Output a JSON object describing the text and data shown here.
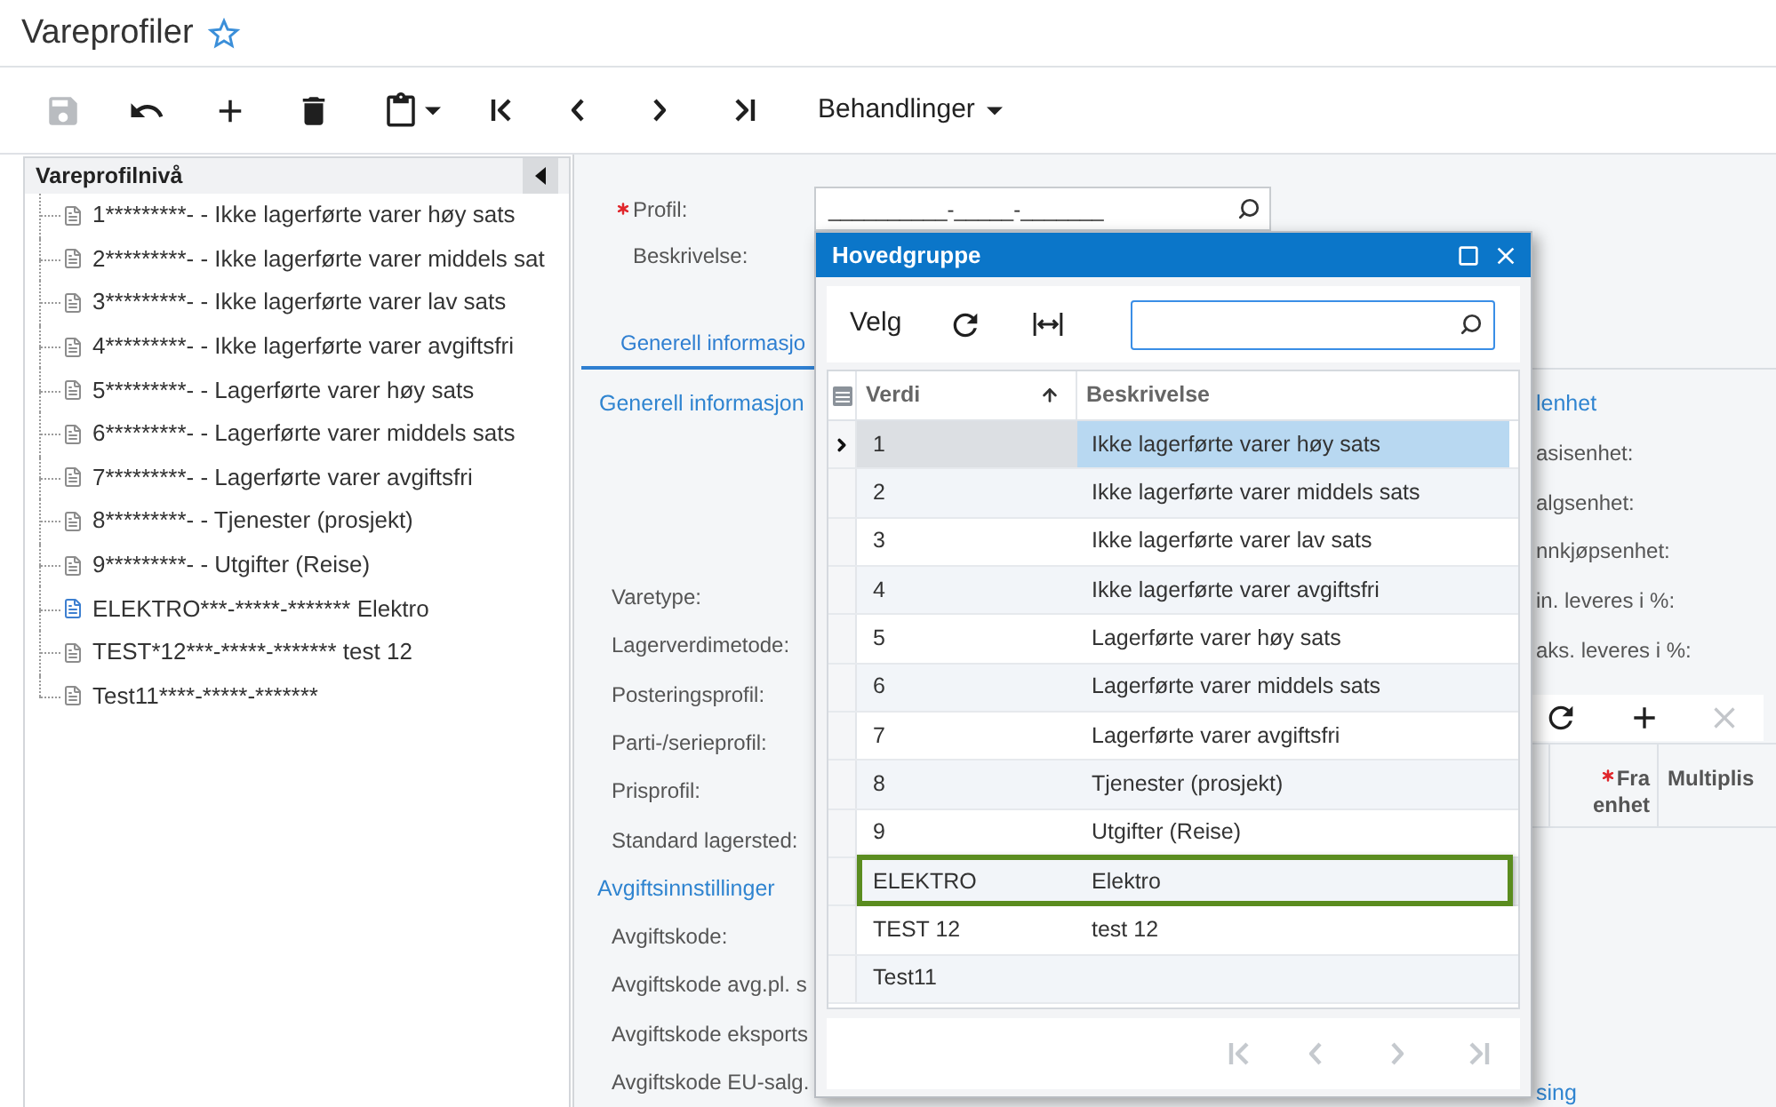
{
  "page": {
    "title": "Vareprofiler",
    "favorite": false
  },
  "toolbar": {
    "buttons": [
      {
        "disabled": true
      },
      {
        "disabled": false
      },
      {
        "disabled": false
      },
      {
        "disabled": false
      },
      {
        "disabled": false
      },
      {
        "disabled": false
      },
      {
        "disabled": false
      },
      {
        "disabled": false
      },
      {
        "disabled": false
      }
    ],
    "menu": "Behandlinger"
  },
  "tree": {
    "title": "Vareprofilnivå",
    "items": [
      {
        "label": "1*********- - Ikke lagerførte varer høy sats",
        "selected": false
      },
      {
        "label": "2*********- - Ikke lagerførte varer middels sat",
        "selected": false
      },
      {
        "label": "3*********- - Ikke lagerførte varer lav sats",
        "selected": false
      },
      {
        "label": "4*********- - Ikke lagerførte varer avgiftsfri",
        "selected": false
      },
      {
        "label": "5*********- - Lagerførte varer høy sats",
        "selected": false
      },
      {
        "label": "6*********- - Lagerførte varer middels sats",
        "selected": false
      },
      {
        "label": "7*********- - Lagerførte varer avgiftsfri",
        "selected": false
      },
      {
        "label": "8*********- - Tjenester (prosjekt)",
        "selected": false
      },
      {
        "label": "9*********- - Utgifter (Reise)",
        "selected": false
      },
      {
        "label": "ELEKTRO***-*****-******* Elektro",
        "selected": true
      },
      {
        "label": "TEST*12***-*****-******* test 12",
        "selected": false
      },
      {
        "label": "Test11****-*****-*******",
        "selected": false
      }
    ]
  },
  "form": {
    "fields": [
      {
        "label": "Profil:",
        "required": true,
        "value": "__________-_____-_______"
      },
      {
        "label": "Beskrivelse:",
        "required": false
      }
    ]
  },
  "tabs": [
    {
      "label": "Generell informasjo",
      "selected": true
    }
  ],
  "general_section": {
    "heading": "Generell informasjon",
    "labels": [
      "Varetype:",
      "Lagerverdimetode:",
      "Posteringsprofil:",
      "Parti-/serieprofil:",
      "Prisprofil:",
      "Standard lagersted:"
    ]
  },
  "tax_section": {
    "heading": "Avgiftsinnstillinger",
    "labels": [
      "Avgiftskode:",
      "Avgiftskode avg.pl. s",
      "Avgiftskode eksports",
      "Avgiftskode EU-salg."
    ]
  },
  "unit_section": {
    "heading": "lenhet",
    "labels": [
      "asisenhet:",
      "algsenhet:",
      "nnkjøpsenhet:",
      "in. leveres i %:",
      "aks. leveres i %:"
    ],
    "grid_toolbar": [
      {
        "disabled": false
      },
      {
        "disabled": false
      },
      {
        "disabled": true
      }
    ],
    "columns": [
      {
        "label": "Fra enhet",
        "required": true
      },
      {
        "label": "Multiplis",
        "required": false
      }
    ]
  },
  "lower_heading": "sing",
  "dialog": {
    "title": "Hovedgruppe",
    "action": "Velg",
    "columns": [
      {
        "label": "Verdi",
        "sorted": true
      },
      {
        "label": "Beskrivelse",
        "sorted": false
      }
    ],
    "rows": [
      {
        "value": "1",
        "description": "Ikke lagerførte varer høy sats",
        "selected": true,
        "highlighted": false
      },
      {
        "value": "2",
        "description": "Ikke lagerførte varer middels sats",
        "selected": false,
        "highlighted": false
      },
      {
        "value": "3",
        "description": "Ikke lagerførte varer lav sats",
        "selected": false,
        "highlighted": false
      },
      {
        "value": "4",
        "description": "Ikke lagerførte varer avgiftsfri",
        "selected": false,
        "highlighted": false
      },
      {
        "value": "5",
        "description": "Lagerførte varer høy sats",
        "selected": false,
        "highlighted": false
      },
      {
        "value": "6",
        "description": "Lagerførte varer middels sats",
        "selected": false,
        "highlighted": false
      },
      {
        "value": "7",
        "description": "Lagerførte varer avgiftsfri",
        "selected": false,
        "highlighted": false
      },
      {
        "value": "8",
        "description": "Tjenester (prosjekt)",
        "selected": false,
        "highlighted": false
      },
      {
        "value": "9",
        "description": "Utgifter (Reise)",
        "selected": false,
        "highlighted": false
      },
      {
        "value": "ELEKTRO",
        "description": "Elektro",
        "selected": false,
        "highlighted": true
      },
      {
        "value": "TEST 12",
        "description": "test 12",
        "selected": false,
        "highlighted": false
      },
      {
        "value": "Test11",
        "selected": false,
        "highlighted": false
      }
    ],
    "pager": [
      {
        "disabled": true
      },
      {
        "disabled": true
      },
      {
        "disabled": true
      },
      {
        "disabled": true
      }
    ]
  }
}
